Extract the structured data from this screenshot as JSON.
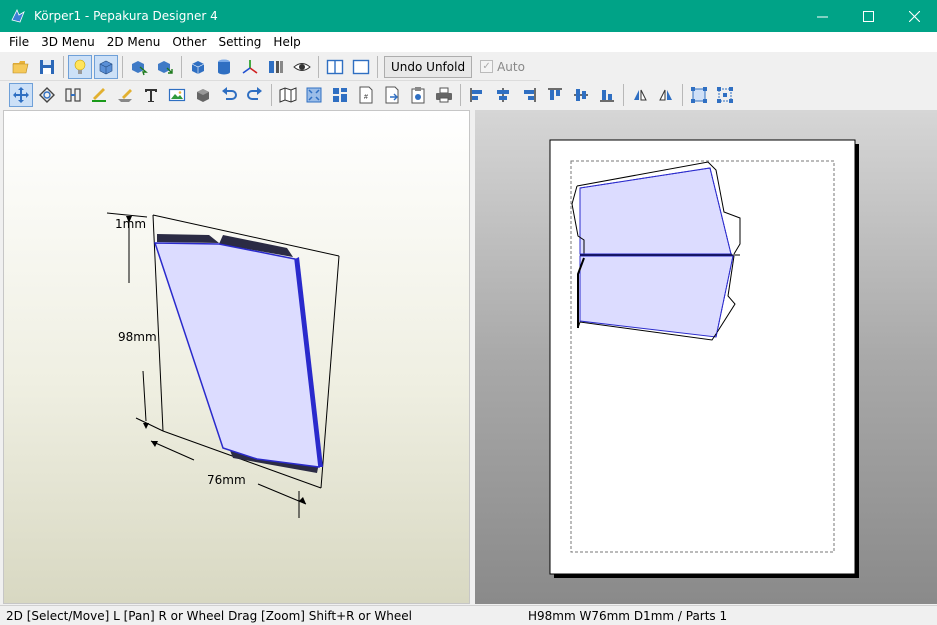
{
  "window": {
    "title": "Körper1 - Pepakura Designer 4"
  },
  "menu": [
    "File",
    "3D Menu",
    "2D Menu",
    "Other",
    "Setting",
    "Help"
  ],
  "toolbar": {
    "undo_unfold_label": "Undo Unfold",
    "auto_label": "Auto",
    "auto_checked": true
  },
  "view3d": {
    "dimensions": {
      "depth": "1mm",
      "height": "98mm",
      "width": "76mm"
    }
  },
  "status": {
    "hint": "2D [Select/Move] L [Pan] R or Wheel Drag [Zoom] Shift+R or Wheel",
    "info": "H98mm W76mm D1mm / Parts 1"
  },
  "colors": {
    "title_bar": "#00a387",
    "face_fill": "#dcdcff",
    "face_edge": "#2a2acc"
  }
}
